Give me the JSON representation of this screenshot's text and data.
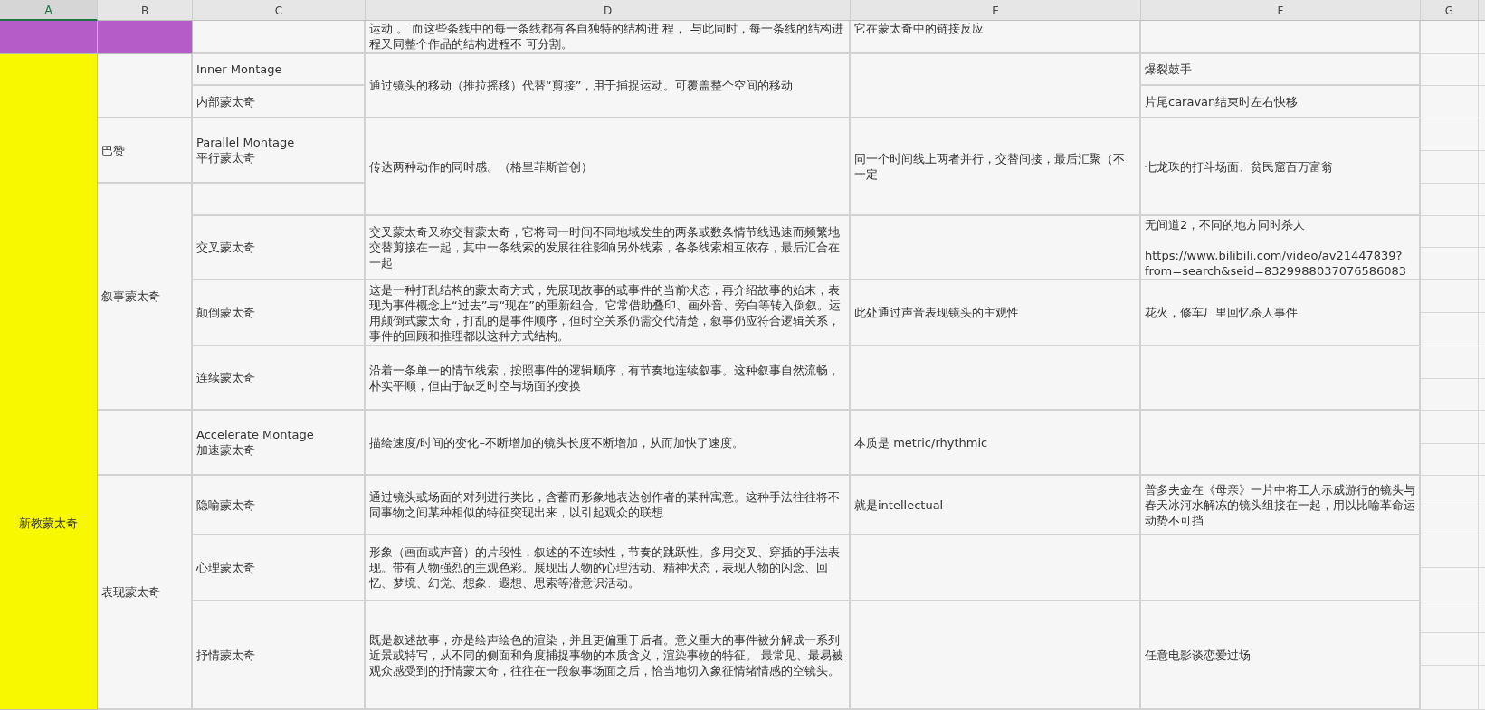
{
  "columns": [
    {
      "label": "A",
      "selected": true
    },
    {
      "label": "B",
      "selected": false
    },
    {
      "label": "C",
      "selected": false
    },
    {
      "label": "D",
      "selected": false
    },
    {
      "label": "E",
      "selected": false
    },
    {
      "label": "F",
      "selected": false
    },
    {
      "label": "G",
      "selected": false
    }
  ],
  "categories": [
    {
      "color": "#b65cc9"
    },
    {
      "text": "新教蒙太奇",
      "color": "#f8f800"
    }
  ],
  "cells": [
    {
      "text": "运动 。 而这些条线中的每一条线都有各自独特的结构进 程， 与此同时，每一条线的结构进程又同整个作品的结构进程不 可分割。"
    },
    {
      "text": "它在蒙太奇中的链接反应"
    },
    {
      "text": "Inner Montage"
    },
    {
      "text": "通过镜头的移动（推拉摇移）代替“剪接”，用于捕捉运动。可覆盖整个空间的移动"
    },
    {
      "text": "爆裂鼓手"
    },
    {
      "text": "内部蒙太奇"
    },
    {
      "text": "片尾caravan结束时左右快移"
    },
    {
      "text": "巴赞"
    },
    {
      "text": "Parallel Montage\n平行蒙太奇"
    },
    {
      "text": "传达两种动作的同时感。（格里菲斯首创）"
    },
    {
      "text": "同一个时间线上两者并行，交替间接，最后汇聚（不一定"
    },
    {
      "text": "七龙珠的打斗场面、贫民窟百万富翁"
    },
    {
      "text": "叙事蒙太奇"
    },
    {
      "text": "交叉蒙太奇"
    },
    {
      "text": "交叉蒙太奇又称交替蒙太奇，它将同一时间不同地域发生的两条或数条情节线迅速而频繁地交替剪接在一起，其中一条线索的发展往往影响另外线索，各条线索相互依存，最后汇合在一起"
    },
    {
      "text": "无间道2，不同的地方同时杀人\n\nhttps://www.bilibili.com/video/av21447839?from=search&seid=8329988037076586083"
    },
    {
      "text": "颠倒蒙太奇"
    },
    {
      "text": "这是一种打乱结构的蒙太奇方式，先展现故事的或事件的当前状态，再介绍故事的始末，表现为事件概念上“过去”与“现在”的重新组合。它常借助叠印、画外音、旁白等转入倒叙。运用颠倒式蒙太奇，打乱的是事件顺序，但时空关系仍需交代清楚，叙事仍应符合逻辑关系，事件的回顾和推理都以这种方式结构。"
    },
    {
      "text": "此处通过声音表现镜头的主观性"
    },
    {
      "text": "花火，修车厂里回忆杀人事件"
    },
    {
      "text": "连续蒙太奇"
    },
    {
      "text": "沿着一条单一的情节线索，按照事件的逻辑顺序，有节奏地连续叙事。这种叙事自然流畅，朴实平顺，但由于缺乏时空与场面的变换"
    },
    {
      "text": "Accelerate Montage\n加速蒙太奇"
    },
    {
      "text": "描绘速度/时间的变化–不断增加的镜头长度不断增加，从而加快了速度。"
    },
    {
      "text": "本质是 metric/rhythmic"
    },
    {
      "text": "表现蒙太奇"
    },
    {
      "text": "隐喻蒙太奇"
    },
    {
      "text": "通过镜头或场面的对列进行类比，含蓄而形象地表达创作者的某种寓意。这种手法往往将不同事物之间某种相似的特征突现出来，以引起观众的联想"
    },
    {
      "text": "就是intellectual"
    },
    {
      "text": "普多夫金在《母亲》一片中将工人示威游行的镜头与春天冰河水解冻的镜头组接在一起，用以比喻革命运动势不可挡"
    },
    {
      "text": "心理蒙太奇"
    },
    {
      "text": "形象（画面或声音）的片段性，叙述的不连续性，节奏的跳跃性。多用交叉、穿插的手法表现。带有人物强烈的主观色彩。展现出人物的心理活动、精神状态，表现人物的闪念、回忆、梦境、幻觉、想象、遐想、思索等潜意识活动。"
    },
    {
      "text": "抒情蒙太奇"
    },
    {
      "text": "既是叙述故事，亦是绘声绘色的渲染，并且更偏重于后者。意义重大的事件被分解成一系列近景或特写，从不同的侧面和角度捕捉事物的本质含义，渲染事物的特征。 最常见、最易被观众感受到的抒情蒙太奇，往往在一段叙事场面之后，恰当地切入象征情绪情感的空镜头。"
    },
    {
      "text": "任意电影谈恋爱过场"
    }
  ]
}
